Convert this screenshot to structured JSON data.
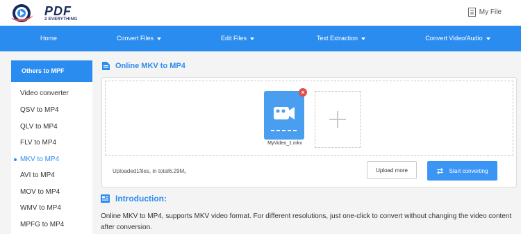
{
  "header": {
    "logo_text": "PDF",
    "logo_subtext": "2 EVERYTHING",
    "my_file_label": "My File"
  },
  "nav": {
    "items": [
      {
        "label": "Home",
        "has_dropdown": false
      },
      {
        "label": "Convert Files",
        "has_dropdown": true
      },
      {
        "label": "Edit Files",
        "has_dropdown": true
      },
      {
        "label": "Text Extraction",
        "has_dropdown": true
      },
      {
        "label": "Convert Video/Audio",
        "has_dropdown": true
      }
    ]
  },
  "sidebar": {
    "header": "Others to MPF",
    "items": [
      {
        "label": "Video converter",
        "active": false
      },
      {
        "label": "QSV to MP4",
        "active": false
      },
      {
        "label": "QLV to MP4",
        "active": false
      },
      {
        "label": "FLV to MP4",
        "active": false
      },
      {
        "label": "MKV to MP4",
        "active": true
      },
      {
        "label": "AVI to MP4",
        "active": false
      },
      {
        "label": "MOV to MP4",
        "active": false
      },
      {
        "label": "WMV to MP4",
        "active": false
      },
      {
        "label": "MPFG to MP4",
        "active": false
      }
    ]
  },
  "main": {
    "title": "Online MKV to MP4",
    "file": {
      "name": "MyVideo_1.mkv"
    },
    "upload_info": "Uploaded1files, in total6.29M。",
    "upload_more_label": "Upload more",
    "start_label": "Start converting"
  },
  "intro": {
    "title": "Introduction:",
    "text": "Online MKV to MP4, supports MKV video format. For different resolutions, just one-click to convert without changing the video content after conversion."
  },
  "colors": {
    "accent": "#2b8cf0",
    "file_icon": "#4a9ef0",
    "remove": "#e34a4a",
    "logo_navy": "#1b2a5e"
  }
}
